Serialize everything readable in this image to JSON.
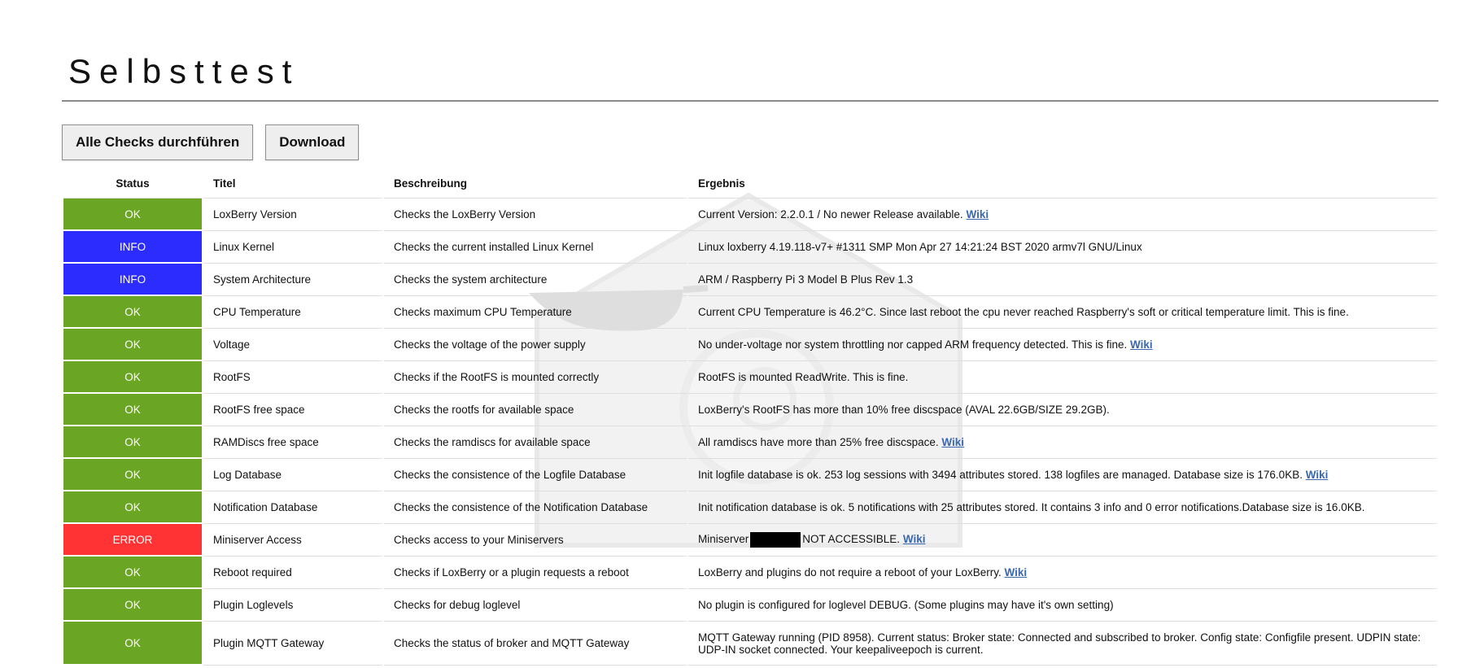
{
  "page": {
    "title": "Selbsttest"
  },
  "toolbar": {
    "run_all_label": "Alle Checks durchführen",
    "download_label": "Download"
  },
  "table": {
    "headers": {
      "status": "Status",
      "title": "Titel",
      "description": "Beschreibung",
      "result": "Ergebnis"
    },
    "rows": [
      {
        "status": "OK",
        "title": "LoxBerry Version",
        "description": "Checks the LoxBerry Version",
        "result": "Current Version: 2.2.0.1 / No newer Release available.",
        "wiki": "Wiki"
      },
      {
        "status": "INFO",
        "title": "Linux Kernel",
        "description": "Checks the current installed Linux Kernel",
        "result": "Linux loxberry 4.19.118-v7+ #1311 SMP Mon Apr 27 14:21:24 BST 2020 armv7l GNU/Linux"
      },
      {
        "status": "INFO",
        "title": "System Architecture",
        "description": "Checks the system architecture",
        "result": "ARM / Raspberry Pi 3 Model B Plus Rev 1.3"
      },
      {
        "status": "OK",
        "title": "CPU Temperature",
        "description": "Checks maximum CPU Temperature",
        "result": "Current CPU Temperature is 46.2°C. Since last reboot the cpu never reached Raspberry's soft or critical temperature limit. This is fine."
      },
      {
        "status": "OK",
        "title": "Voltage",
        "description": "Checks the voltage of the power supply",
        "result": "No under-voltage nor system throttling nor capped ARM frequency detected. This is fine.",
        "wiki": "Wiki"
      },
      {
        "status": "OK",
        "title": "RootFS",
        "description": "Checks if the RootFS is mounted correctly",
        "result": "RootFS is mounted ReadWrite. This is fine."
      },
      {
        "status": "OK",
        "title": "RootFS free space",
        "description": "Checks the rootfs for available space",
        "result": "LoxBerry's RootFS has more than 10% free discspace (AVAL 22.6GB/SIZE 29.2GB)."
      },
      {
        "status": "OK",
        "title": "RAMDiscs free space",
        "description": "Checks the ramdiscs for available space",
        "result": "All ramdiscs have more than 25% free discspace.",
        "wiki": "Wiki"
      },
      {
        "status": "OK",
        "title": "Log Database",
        "description": "Checks the consistence of the Logfile Database",
        "result": "Init logfile database is ok. 253 log sessions with 3494 attributes stored. 138 logfiles are managed. Database size is 176.0KB.",
        "wiki": "Wiki"
      },
      {
        "status": "OK",
        "title": "Notification Database",
        "description": "Checks the consistence of the Notification Database",
        "result": "Init notification database is ok. 5 notifications with 25 attributes stored. It contains 3 info and 0 error notifications.Database size is 16.0KB."
      },
      {
        "status": "ERROR",
        "title": "Miniserver Access",
        "description": "Checks access to your Miniservers",
        "result": "Miniserver",
        "result_suffix": "NOT ACCESSIBLE.",
        "wiki": "Wiki"
      },
      {
        "status": "OK",
        "title": "Reboot required",
        "description": "Checks if LoxBerry or a plugin requests a reboot",
        "result": "LoxBerry and plugins do not require a reboot of your LoxBerry.",
        "wiki": "Wiki"
      },
      {
        "status": "OK",
        "title": "Plugin Loglevels",
        "description": "Checks for debug loglevel",
        "result": "No plugin is configured for loglevel DEBUG. (Some plugins may have it's own setting)"
      },
      {
        "status": "OK",
        "title": "Plugin MQTT Gateway",
        "description": "Checks the status of broker and MQTT Gateway",
        "result": "MQTT Gateway running (PID 8958). Current status: Broker state: Connected and subscribed to broker. Config state: Configfile present. UDPIN state: UDP-IN socket connected. Your keepaliveepoch is current."
      }
    ]
  },
  "colors": {
    "ok": "#6aa624",
    "info": "#2c2cff",
    "error": "#ff3333",
    "link": "#3a67b0"
  }
}
